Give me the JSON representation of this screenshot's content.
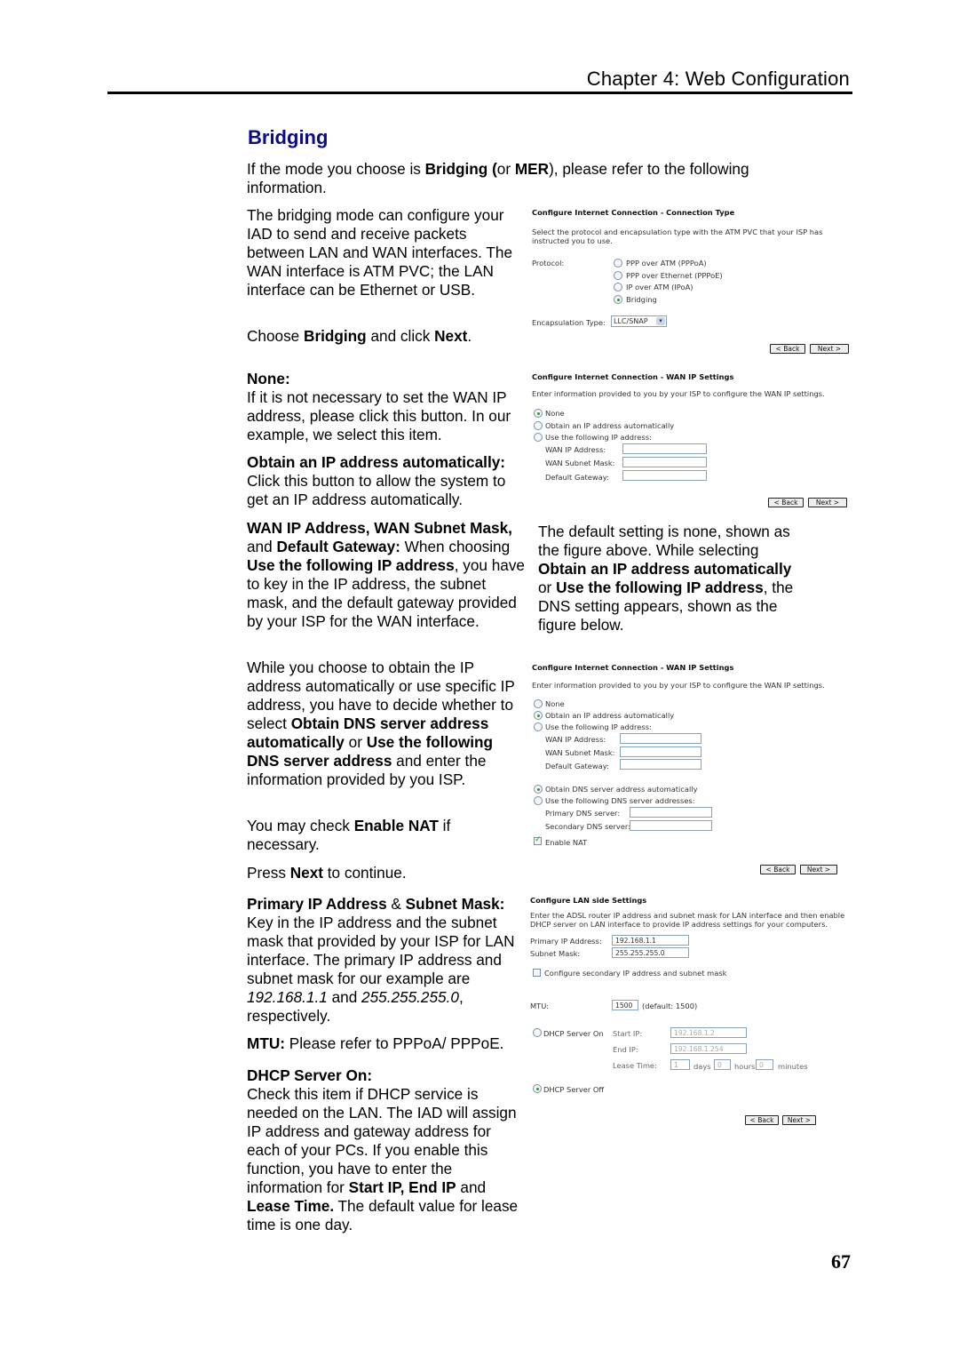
{
  "header": {
    "chapter": "Chapter 4: Web Configuration"
  },
  "section_title": "Bridging",
  "intro": {
    "t1": "If the mode you choose is ",
    "b1": "Bridging (",
    "t2": "or ",
    "b2": "MER",
    "t3": "), please refer to the following information."
  },
  "left": {
    "p1": "The bridging mode can configure your IAD to send and receive packets between LAN and WAN interfaces. The WAN interface is ATM PVC; the LAN interface can be Ethernet or USB.",
    "p2": {
      "t1": "Choose ",
      "b1": "Bridging",
      "t2": " and click ",
      "b2": "Next",
      "t3": "."
    },
    "none": {
      "title": "None:",
      "body": "If it is not necessary to set the WAN IP address, please click this button. In our example, we select this item."
    },
    "obtain": {
      "title": "Obtain an IP address automatically:",
      "body": "Click this button to allow the system to get an IP address automatically."
    },
    "wan": {
      "b1": "WAN IP Address, WAN Subnet Mask,",
      "t1": " and ",
      "b2": "Default Gateway:",
      "t2": " When choosing ",
      "b3": "Use the following IP address",
      "t3": ", you have to key in the IP address, the subnet mask, and the default gateway provided by your ISP for the WAN interface."
    },
    "dns": {
      "t1": "While you choose to obtain the IP address automatically or use specific IP address, you have to decide whether to select ",
      "b1": "Obtain DNS server address automatically",
      "t2": " or ",
      "b2": "Use the following DNS server address",
      "t3": " and enter the information provided by you ISP."
    },
    "nat": {
      "t1": "You may check ",
      "b1": "Enable NAT",
      "t2": " if necessary."
    },
    "press": {
      "t1": "Press ",
      "b1": "Next",
      "t2": " to continue."
    },
    "primary": {
      "b1": "Primary IP Address",
      "t1": " & ",
      "b2": "Subnet Mask:",
      "t2": " Key in the IP address and the subnet mask that provided by your ISP for LAN interface. The primary IP address and subnet mask for our example are ",
      "i1": "192.168.1.1",
      "t3": " and ",
      "i2": "255.255.255.0",
      "t4": ", respectively."
    },
    "mtu": {
      "b1": "MTU:",
      "t1": " Please refer to PPPoA/ PPPoE."
    },
    "dhcp": {
      "title": "DHCP Server On:",
      "t1": "Check this item if DHCP service is needed on the LAN. The IAD will assign IP address and gateway address for each of your PCs. If you enable this function, you have to enter the information for ",
      "b1": "Start IP, End IP",
      "t2": " and ",
      "b2": "Lease Time.",
      "t3": " The default value for lease time is one day."
    }
  },
  "right": {
    "default_note": {
      "t1": "The default setting is none, shown as the figure above. While selecting ",
      "b1": "Obtain an IP address automatically",
      "t2": " or ",
      "b2": "Use the following IP address",
      "t3": ", the DNS setting appears, shown as the figure below."
    }
  },
  "panel1": {
    "title": "Configure Internet Connection - Connection Type",
    "desc": "Select the protocol and encapsulation type with the ATM PVC that your ISP has instructed you to use.",
    "protocol_label": "Protocol:",
    "options": [
      {
        "label": "PPP over ATM (PPPoA)",
        "selected": false
      },
      {
        "label": "PPP over Ethernet (PPPoE)",
        "selected": false
      },
      {
        "label": "IP over ATM (IPoA)",
        "selected": false
      },
      {
        "label": "Bridging",
        "selected": true
      }
    ],
    "encap_label": "Encapsulation Type:",
    "encap_value": "LLC/SNAP",
    "back": "< Back",
    "next": "Next >"
  },
  "panel2": {
    "title": "Configure Internet Connection - WAN IP Settings",
    "desc": "Enter information provided to you by your ISP to configure the WAN IP settings.",
    "options": [
      {
        "label": "None",
        "selected": true
      },
      {
        "label": "Obtain an IP address automatically",
        "selected": false
      },
      {
        "label": "Use the following IP address:",
        "selected": false
      }
    ],
    "fields": [
      {
        "label": "WAN IP Address:",
        "value": ""
      },
      {
        "label": "WAN Subnet Mask:",
        "value": ""
      },
      {
        "label": "Default Gateway:",
        "value": ""
      }
    ],
    "back": "< Back",
    "next": "Next >"
  },
  "panel3": {
    "title": "Configure Internet Connection - WAN IP Settings",
    "desc": "Enter information provided to you by your ISP to configure the WAN IP settings.",
    "options": [
      {
        "label": "None",
        "selected": false
      },
      {
        "label": "Obtain an IP address automatically",
        "selected": true
      },
      {
        "label": "Use the following IP address:",
        "selected": false
      }
    ],
    "fields": [
      {
        "label": "WAN IP Address:",
        "value": ""
      },
      {
        "label": "WAN Subnet Mask:",
        "value": ""
      },
      {
        "label": "Default Gateway:",
        "value": ""
      }
    ],
    "dns_options": [
      {
        "label": "Obtain DNS server address automatically",
        "selected": true
      },
      {
        "label": "Use the following DNS server addresses:",
        "selected": false
      }
    ],
    "dns_fields": [
      {
        "label": "Primary DNS server:",
        "value": ""
      },
      {
        "label": "Secondary DNS server:",
        "value": ""
      }
    ],
    "nat_label": "Enable NAT",
    "nat_checked": true,
    "back": "< Back",
    "next": "Next >"
  },
  "panel4": {
    "title": "Configure LAN side Settings",
    "desc": "Enter the ADSL router IP address and subnet mask for LAN interface and then enable DHCP server on LAN interface to provide IP address settings for your computers.",
    "primary_ip_label": "Primary IP Address:",
    "primary_ip_value": "192.168.1.1",
    "subnet_label": "Subnet Mask:",
    "subnet_value": "255.255.255.0",
    "secondary_label": "Configure secondary IP address and subnet mask",
    "secondary_checked": false,
    "mtu_label": "MTU:",
    "mtu_value": "1500",
    "mtu_default": "(default: 1500)",
    "dhcp_on_label": "DHCP Server On",
    "dhcp_on_selected": false,
    "start_ip_label": "Start IP:",
    "start_ip_value": "192.168.1.2",
    "end_ip_label": "End IP:",
    "end_ip_value": "192.168.1.254",
    "lease_label": "Lease Time:",
    "lease_days": "1",
    "days_label": "days",
    "lease_hours": "0",
    "hours_label": "hours",
    "lease_minutes": "0",
    "minutes_label": "minutes",
    "dhcp_off_label": "DHCP Server Off",
    "dhcp_off_selected": true,
    "back": "< Back",
    "next": "Next >"
  },
  "page_number": "67"
}
